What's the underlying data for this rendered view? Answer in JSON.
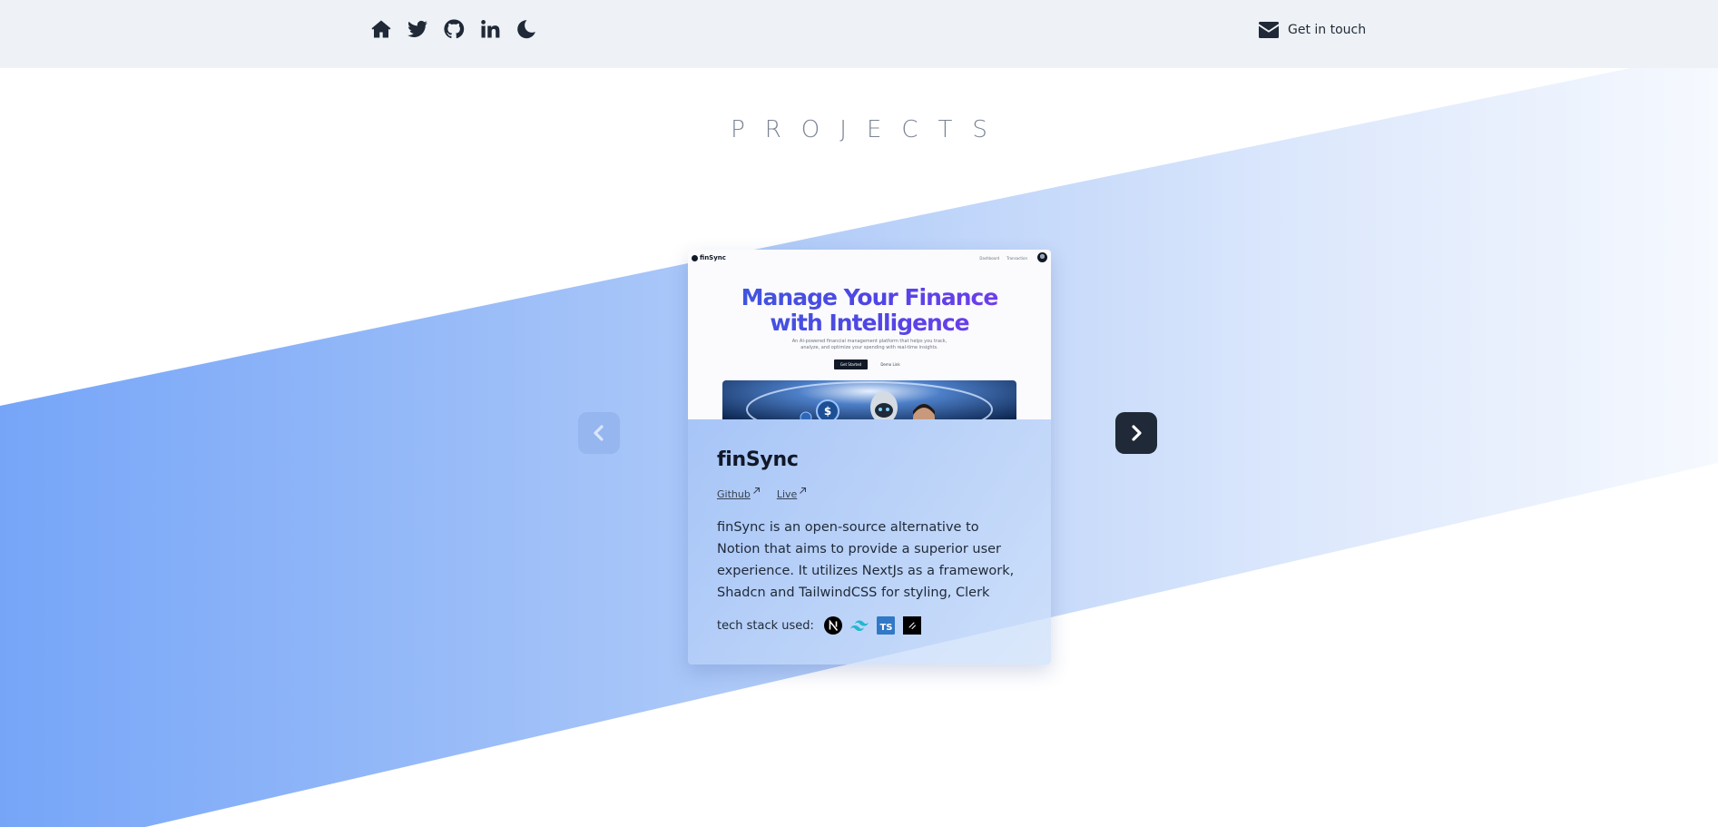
{
  "nav": {
    "icons": [
      "home-icon",
      "twitter-icon",
      "github-icon",
      "linkedin-icon",
      "moon-icon"
    ],
    "contact_label": "Get in touch",
    "contact_icon": "envelope-icon"
  },
  "section": {
    "title": "PROJECTS"
  },
  "carousel": {
    "prev_icon": "chevron-left-icon",
    "next_icon": "chevron-right-icon"
  },
  "project": {
    "title": "finSync",
    "links": {
      "github_label": "Github",
      "live_label": "Live"
    },
    "description": "finSync is an open-source alternative to Notion that aims to provide a superior user experience. It utilizes NextJs as a framework, Shadcn and TailwindCSS for styling, Clerk for…",
    "tech_stack_label": "tech stack used:",
    "tech_stack_icons": [
      "nextjs-icon",
      "tailwindcss-icon",
      "typescript-icon",
      "shadcn-icon"
    ],
    "preview": {
      "logo_text": "finSync",
      "nav_links": [
        "Dashboard",
        "Transaction"
      ],
      "headline_line1": "Manage Your Finance",
      "headline_line2": "with Intelligence",
      "subtext": "An AI-powered financial management platform that helps you track, analyze, and optimize your spending with real-time insights.",
      "primary_button": "Get Started",
      "secondary_button": "Demo Link"
    }
  },
  "colors": {
    "topbar_bg": "#eef2f6",
    "band_start": "#76a5f8",
    "band_end": "#e8f0fd",
    "next_button": "#1f2937",
    "prev_button": "#96b6ef",
    "headline_gradient_start": "#3b5bdb",
    "headline_gradient_end": "#7c3aed"
  }
}
